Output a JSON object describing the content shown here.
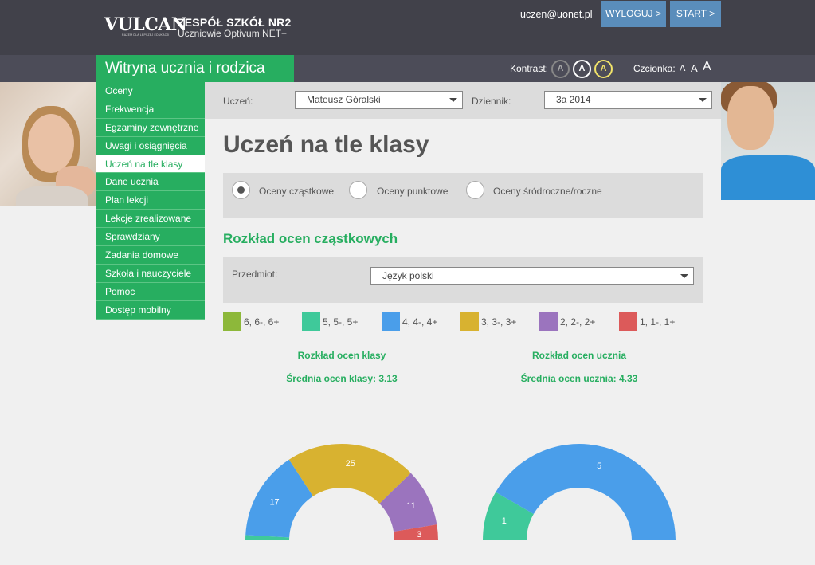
{
  "header": {
    "logo_text": "VULCAN",
    "logo_tagline": "RAZEM DLA LEPSZEJ EDUKACJI",
    "school_name": "ZESPÓŁ SZKÓŁ NR2",
    "app_name": "Uczniowie Optivum NET+",
    "user_email": "uczen@uonet.pl",
    "logout_label": "WYLOGUJ >",
    "start_label": "START >",
    "portal_title": "Witryna ucznia i rodzica",
    "contrast_label": "Kontrast:",
    "contrast_options": [
      "A",
      "A",
      "A"
    ],
    "font_label": "Czcionka:",
    "font_options": [
      "A",
      "A",
      "A"
    ]
  },
  "sidebar": {
    "items": [
      {
        "label": "Oceny"
      },
      {
        "label": "Frekwencja"
      },
      {
        "label": "Egzaminy zewnętrzne"
      },
      {
        "label": "Uwagi i osiągnięcia"
      },
      {
        "label": "Uczeń na tle klasy",
        "active": true
      },
      {
        "label": "Dane ucznia"
      },
      {
        "label": "Plan lekcji"
      },
      {
        "label": "Lekcje zrealizowane"
      },
      {
        "label": "Sprawdziany"
      },
      {
        "label": "Zadania domowe"
      },
      {
        "label": "Szkoła i nauczyciele"
      },
      {
        "label": "Pomoc"
      },
      {
        "label": "Dostęp mobilny"
      }
    ]
  },
  "filters": {
    "student_label": "Uczeń:",
    "student_value": "Mateusz Góralski",
    "journal_label": "Dziennik:",
    "journal_value": "3a 2014"
  },
  "page_title": "Uczeń na tle klasy",
  "grade_types": {
    "options": [
      {
        "label": "Oceny cząstkowe",
        "selected": true
      },
      {
        "label": "Oceny punktowe",
        "selected": false
      },
      {
        "label": "Oceny śródroczne/roczne",
        "selected": false
      }
    ]
  },
  "section_title": "Rozkład ocen cząstkowych",
  "subject": {
    "label": "Przedmiot:",
    "value": "Język polski"
  },
  "legend": [
    {
      "label": "6, 6-, 6+",
      "color": "#8db83a"
    },
    {
      "label": "5, 5-, 5+",
      "color": "#3fc99a"
    },
    {
      "label": "4, 4-, 4+",
      "color": "#4a9eea"
    },
    {
      "label": "3, 3-, 3+",
      "color": "#d8b230"
    },
    {
      "label": "2, 2-, 2+",
      "color": "#9b74be"
    },
    {
      "label": "1, 1-, 1+",
      "color": "#dc5a5a"
    }
  ],
  "class_chart_info": {
    "title": "Rozkład ocen klasy",
    "average": "Średnia ocen klasy: 3.13"
  },
  "student_chart_info": {
    "title": "Rozkład ocen ucznia",
    "average": "Średnia ocen ucznia: 4.33"
  },
  "chart_data": [
    {
      "type": "pie",
      "subtype": "semicircle-donut",
      "title": "Rozkład ocen klasy",
      "categories": [
        "6, 6-, 6+",
        "5, 5-, 5+",
        "4, 4-, 4+",
        "3, 3-, 3+",
        "2, 2-, 2+",
        "1, 1-, 1+"
      ],
      "values": [
        0,
        1,
        17,
        25,
        11,
        3
      ],
      "data_labels": [
        "",
        "",
        "17",
        "25",
        "11",
        "3"
      ],
      "colors": [
        "#8db83a",
        "#3fc99a",
        "#4a9eea",
        "#d8b230",
        "#9b74be",
        "#dc5a5a"
      ]
    },
    {
      "type": "pie",
      "subtype": "semicircle-donut",
      "title": "Rozkład ocen ucznia",
      "categories": [
        "6, 6-, 6+",
        "5, 5-, 5+",
        "4, 4-, 4+",
        "3, 3-, 3+",
        "2, 2-, 2+",
        "1, 1-, 1+"
      ],
      "values": [
        0,
        1,
        5,
        0,
        0,
        0
      ],
      "data_labels": [
        "",
        "1",
        "5",
        "",
        "",
        ""
      ],
      "colors": [
        "#8db83a",
        "#3fc99a",
        "#4a9eea",
        "#d8b230",
        "#9b74be",
        "#dc5a5a"
      ]
    }
  ]
}
